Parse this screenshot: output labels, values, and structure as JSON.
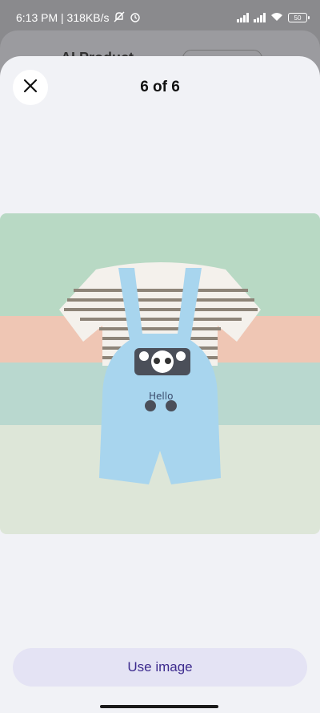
{
  "status_bar": {
    "time_speed": "6:13 PM | 318KB/s",
    "battery": "50"
  },
  "background": {
    "title": "AI Product...",
    "back_icon": "back-arrow-icon"
  },
  "viewer": {
    "counter": "6 of 6",
    "close_icon": "close-icon",
    "photo_label": "Hello"
  },
  "actions": {
    "use_image": "Use image"
  },
  "colors": {
    "sheet": "#f1f2f6",
    "button_bg": "#e4e3f4",
    "button_text": "#3d2b8e"
  }
}
